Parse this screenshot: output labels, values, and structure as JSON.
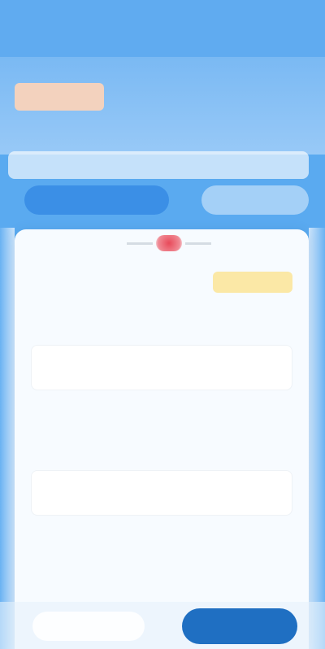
{
  "status_bar": {
    "text": ""
  },
  "header": {
    "brand_label": ""
  },
  "notice": {
    "text": ""
  },
  "tabs": [
    {
      "label": "",
      "active": true
    },
    {
      "label": "",
      "active": false
    }
  ],
  "card": {
    "status_chip": "",
    "rows": [
      {
        "title": "",
        "value": ""
      },
      {
        "title": "",
        "value": ""
      },
      {
        "title": "",
        "value": ""
      },
      {
        "title": "",
        "value": ""
      },
      {
        "title": "",
        "value": ""
      },
      {
        "title": "",
        "value": ""
      }
    ],
    "inputs": [
      {
        "value": ""
      },
      {
        "value": ""
      }
    ]
  },
  "actions": {
    "secondary_label": "",
    "primary_label": ""
  },
  "colors": {
    "primary": "#1f6fc2",
    "accent_tab": "#3b8fe6",
    "status_chip_bg": "#fbe8a6",
    "header_bg": "#7ab9f3",
    "brand_badge_bg": "#f3d2be",
    "logo_red": "#e84a5a"
  }
}
